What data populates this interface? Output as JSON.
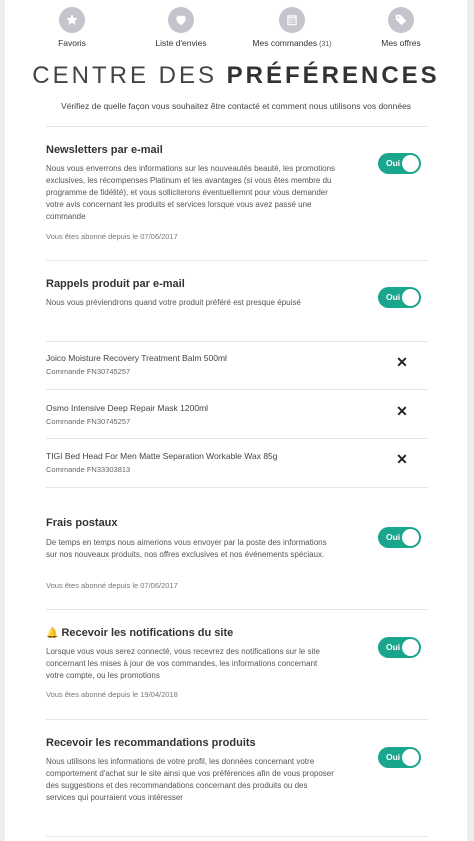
{
  "nav": {
    "items": [
      {
        "label": "Favoris",
        "icon": "star-icon"
      },
      {
        "label": "Liste d'envies",
        "icon": "heart-icon"
      },
      {
        "label": "Mes commandes",
        "count": "(31)",
        "icon": "calendar-icon"
      },
      {
        "label": "Mes offres",
        "icon": "tag-icon"
      }
    ]
  },
  "page": {
    "title_light": "CENTRE DES ",
    "title_bold": "PRÉFÉRENCES",
    "subtitle": "Vérifiez de quelle façon vous souhaitez être contacté et comment nous utilisons vos données"
  },
  "sections": {
    "newsletter": {
      "title": "Newsletters par e-mail",
      "description": "Nous vous enverrons des informations sur les nouveautés beauté, les promotions exclusives, les récompenses Platinum et les avantages (si vous êtes membre du programme de fidélité), et vous solliciterons éventuellemnt pour vous demander votre avis concernant les produits et services lorsque vous avez passé une commande",
      "since": "Vous êtes abonné depuis le 07/06/2017",
      "toggle": "Oui"
    },
    "reminders": {
      "title": "Rappels produit par e-mail",
      "description": "Nous vous préviendrons quand votre produit préféré est presque épuisé",
      "toggle": "Oui",
      "products": [
        {
          "name": "Joico Moisture Recovery Treatment Balm 500ml",
          "order": "Commande FN30745257",
          "remove": "✕"
        },
        {
          "name": "Osmo Intensive Deep Repair Mask 1200ml",
          "order": "Commande FN30745257",
          "remove": "✕"
        },
        {
          "name": "TIGI Bed Head For Men Matte Separation Workable Wax 85g",
          "order": "Commande FN33303813",
          "remove": "✕"
        }
      ]
    },
    "postal": {
      "title": "Frais postaux",
      "description": "De temps en temps nous aimerions vous envoyer par la poste des informations sur nos nouveaux produits, nos offres exclusives et nos événements spéciaux.",
      "since": "Vous êtes abonné depuis le 07/06/2017",
      "toggle": "Oui"
    },
    "notifications": {
      "title": "Recevoir les notifications du site",
      "description": "Lorsque vous vous serez connecté, vous recevrez des notifications sur le site concernant les mises à jour de vos commandes, les informations concernant votre compte, ou les promotions",
      "since": "Vous êtes abonné depuis le 19/04/2018",
      "toggle": "Oui"
    },
    "recommendations": {
      "title": "Recevoir les recommandations produits",
      "description": "Nous utilisons les informations de votre profil, les données concernant votre comportement d'achat sur le site ainsi que vos préférences afin de vous proposer des suggestions et des recommandations concernant des produits ou des services qui pourraient vous intéresser",
      "toggle": "Oui"
    }
  },
  "colors": {
    "accent": "#1aa68d",
    "nav_icon": "#c5c3cb"
  }
}
